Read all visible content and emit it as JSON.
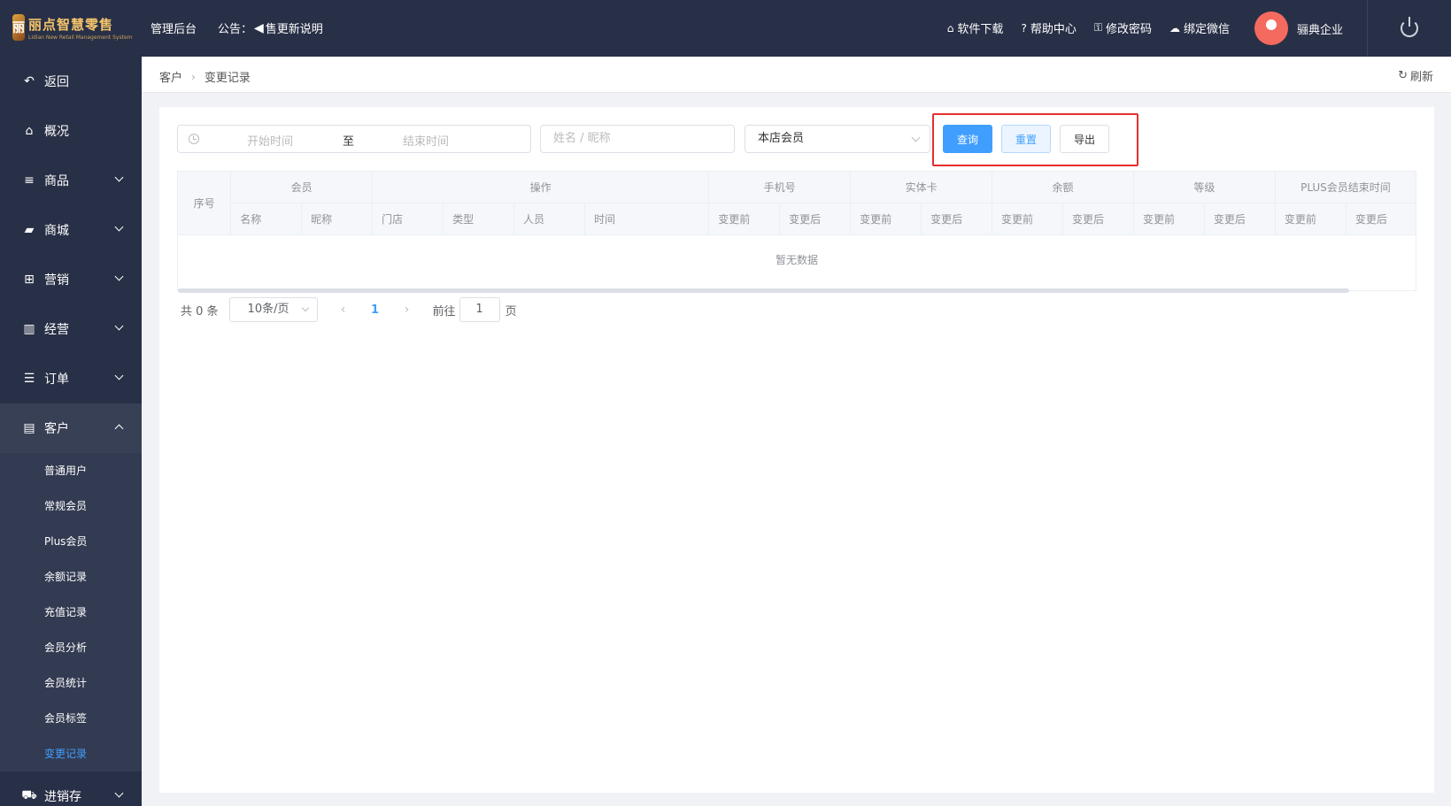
{
  "app": {
    "logo_text": "丽点智慧零售",
    "logo_sub": "Lidian New Retail Management System",
    "title": "管理后台",
    "notice_label": "公告：",
    "notice_text": "售更新说明"
  },
  "top_links": [
    {
      "icon": "store-icon",
      "label": "软件下载"
    },
    {
      "icon": "help-icon",
      "label": "帮助中心"
    },
    {
      "icon": "key-icon",
      "label": "修改密码"
    },
    {
      "icon": "wechat-icon",
      "label": "绑定微信"
    }
  ],
  "user": {
    "name": "骊典企业"
  },
  "sidebar": {
    "items": [
      {
        "icon": "back-icon",
        "label": "返回"
      },
      {
        "icon": "home-icon",
        "label": "概况"
      },
      {
        "icon": "list-icon",
        "label": "商品"
      },
      {
        "icon": "bag-icon",
        "label": "商城"
      },
      {
        "icon": "gift-icon",
        "label": "营销"
      },
      {
        "icon": "chart-icon",
        "label": "经营"
      },
      {
        "icon": "order-icon",
        "label": "订单"
      },
      {
        "icon": "card-icon",
        "label": "客户"
      }
    ],
    "sub_items": [
      "普通用户",
      "常规会员",
      "Plus会员",
      "余额记录",
      "充值记录",
      "会员分析",
      "会员统计",
      "会员标签",
      "变更记录"
    ],
    "last_item": {
      "icon": "truck-icon",
      "label": "进销存"
    }
  },
  "breadcrumb": {
    "parent": "客户",
    "current": "变更记录",
    "refresh": "刷新"
  },
  "filters": {
    "start_placeholder": "开始时间",
    "range_sep": "至",
    "end_placeholder": "结束时间",
    "name_placeholder": "姓名 / 昵称",
    "member_type": "本店会员"
  },
  "buttons": {
    "query": "查询",
    "reset": "重置",
    "export": "导出"
  },
  "table": {
    "col_index": "序号",
    "groups": [
      "会员",
      "操作",
      "手机号",
      "实体卡",
      "余额",
      "等级",
      "PLUS会员结束时间"
    ],
    "member_cols": [
      "名称",
      "昵称"
    ],
    "op_cols": [
      "门店",
      "类型",
      "人员",
      "时间"
    ],
    "before": "变更前",
    "after": "变更后",
    "empty_text": "暂无数据"
  },
  "pager": {
    "total": "共 0 条",
    "page_size": "10条/页",
    "current_page": "1",
    "goto_label": "前往",
    "goto_value": "1",
    "goto_suffix": "页"
  },
  "colors": {
    "primary": "#409eff",
    "sidebar_bg": "#283047",
    "highlight_box": "#e52e2e"
  }
}
